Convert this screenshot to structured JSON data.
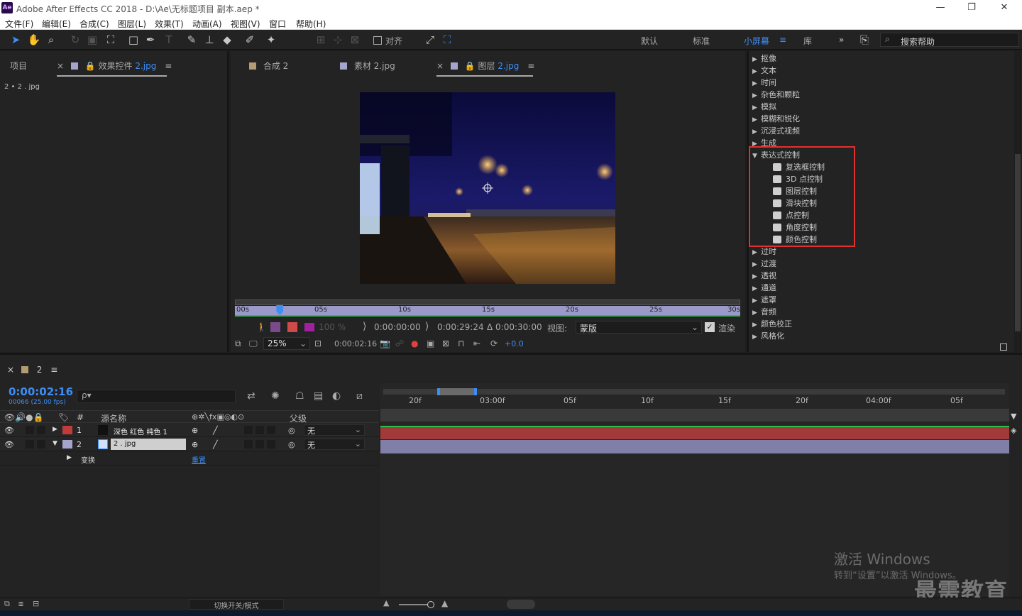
{
  "window": {
    "title": "Adobe After Effects CC 2018 - D:\\Ae\\无标题项目 副本.aep *",
    "logo": "Ae"
  },
  "menu": [
    "文件(F)",
    "编辑(E)",
    "合成(C)",
    "图层(L)",
    "效果(T)",
    "动画(A)",
    "视图(V)",
    "窗口",
    "帮助(H)"
  ],
  "toolbar": {
    "snap_label": "对齐",
    "workspaces": [
      "默认",
      "标准",
      "小屏幕",
      "库"
    ],
    "active_workspace": "小屏幕",
    "search_text": "搜索帮助"
  },
  "project_panel": {
    "tab_project": "项目",
    "tab_effects": "效果控件",
    "tab_effects_target": "2.jpg",
    "subtitle": "2 • 2 . jpg"
  },
  "viewer": {
    "tabs": [
      {
        "label": "合成",
        "target": "2"
      },
      {
        "label": "素材",
        "target": "2.jpg"
      },
      {
        "label": "图层",
        "target": "2.jpg"
      }
    ],
    "ruler_ticks": [
      "00s",
      "05s",
      "10s",
      "15s",
      "20s",
      "25s",
      "30s"
    ],
    "playhead_fraction": 0.089,
    "opacity": "100 %",
    "in_point": "0:00:00:00",
    "out_point": "0:00:29:24",
    "duration": "Δ 0:00:30:00",
    "view_label": "视图:",
    "view_value": "蒙版",
    "render_label": "渲染",
    "zoom": "25%",
    "current_time": "0:00:02:16",
    "exposure": "+0.0"
  },
  "effects": {
    "items": [
      {
        "label": "抠像",
        "expanded": false
      },
      {
        "label": "文本",
        "expanded": false
      },
      {
        "label": "时间",
        "expanded": false
      },
      {
        "label": "杂色和颗粒",
        "expanded": false
      },
      {
        "label": "模拟",
        "expanded": false
      },
      {
        "label": "模糊和锐化",
        "expanded": false
      },
      {
        "label": "沉浸式视频",
        "expanded": false
      },
      {
        "label": "生成",
        "expanded": false
      },
      {
        "label": "表达式控制",
        "expanded": true
      },
      {
        "label": "过时",
        "expanded": false
      },
      {
        "label": "过渡",
        "expanded": false
      },
      {
        "label": "透视",
        "expanded": false
      },
      {
        "label": "通道",
        "expanded": false
      },
      {
        "label": "遮罩",
        "expanded": false
      },
      {
        "label": "音频",
        "expanded": false
      },
      {
        "label": "颜色校正",
        "expanded": false
      },
      {
        "label": "风格化",
        "expanded": false
      }
    ],
    "expression_controls": [
      "复选框控制",
      "3D 点控制",
      "图层控制",
      "滑块控制",
      "点控制",
      "角度控制",
      "颜色控制"
    ]
  },
  "timeline": {
    "comp_tab": "2",
    "timecode": "0:00:02:16",
    "fps": "00066 (25.00 fps)",
    "search_icon_text": "ρ▾",
    "columns": {
      "num": "#",
      "source": "源名称",
      "parent": "父级"
    },
    "layers": [
      {
        "num": "1",
        "name": "深色 红色 纯色 1",
        "parent": "无",
        "color": "#c23b3b"
      },
      {
        "num": "2",
        "name": "2 . jpg",
        "parent": "无",
        "color": "#a4a4cc"
      }
    ],
    "transform_label": "变换",
    "reset_label": "重置",
    "ruler_ticks": [
      "20f",
      "03:00f",
      "05f",
      "10f",
      "15f",
      "20f",
      "04:00f",
      "05f"
    ],
    "toggle_label": "切换开关/模式"
  },
  "watermark": {
    "line1": "激活 Windows",
    "line2": "转到“设置”以激活 Windows。",
    "brand": "最需教育"
  },
  "colors": {
    "accent": "#3d8df5",
    "highlight_box": "#e03030",
    "layer_red": "#a23a3a",
    "layer_purple": "#7f7fa8"
  }
}
